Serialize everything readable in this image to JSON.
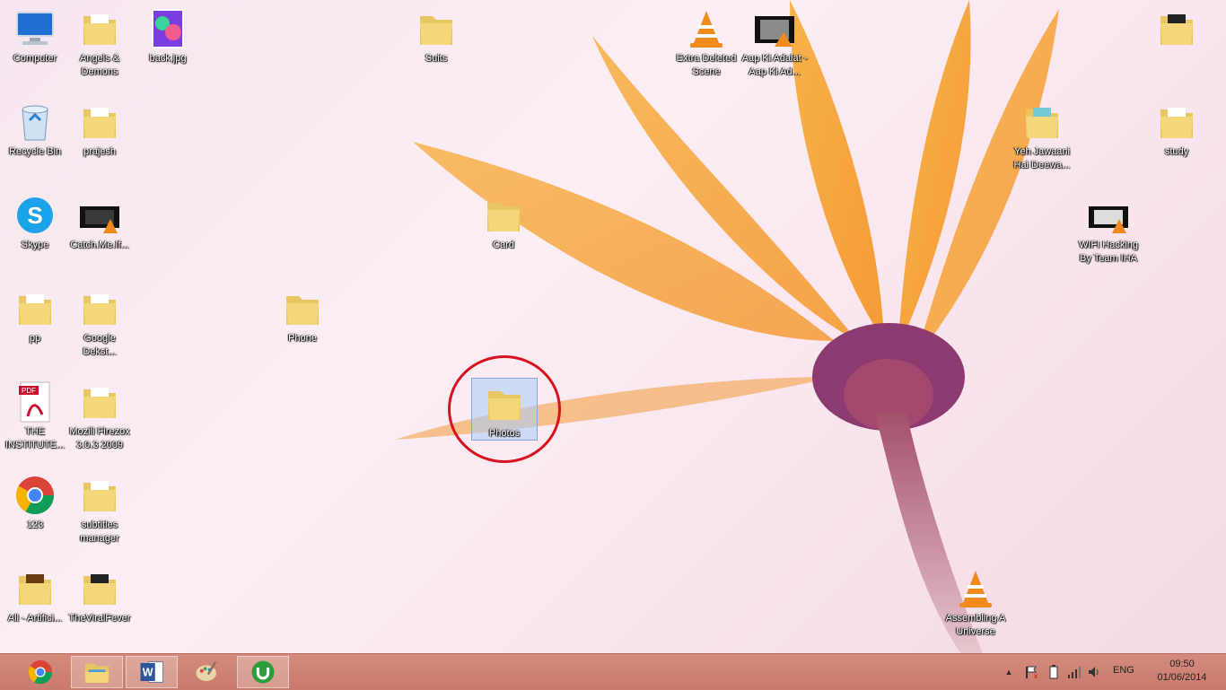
{
  "desktop": {
    "icons": [
      {
        "label": "Computer",
        "icon": "computer-icon"
      },
      {
        "label": "Angels & Demons",
        "icon": "folder-icon"
      },
      {
        "label": "back.jpg",
        "icon": "image-file-icon"
      },
      {
        "label": "Suits",
        "icon": "folder-icon"
      },
      {
        "label": "Extra Deleted Scene",
        "icon": "vlc-icon"
      },
      {
        "label": "Aap Ki Adalat - Aap Ki Ad...",
        "icon": "video-file-icon"
      },
      {
        "label": "Recycle Bin",
        "icon": "recycle-bin-icon"
      },
      {
        "label": "prajesh",
        "icon": "folder-icon"
      },
      {
        "label": "Yeh Jawaani Hai Deewa...",
        "icon": "folder-icon"
      },
      {
        "label": "study",
        "icon": "folder-icon"
      },
      {
        "label": "Skype",
        "icon": "skype-icon"
      },
      {
        "label": "Catch.Me.If...",
        "icon": "video-file-icon"
      },
      {
        "label": "Card",
        "icon": "folder-icon"
      },
      {
        "label": "WIFI Hacking By Team IHA",
        "icon": "video-file-icon"
      },
      {
        "label": "pp",
        "icon": "folder-icon"
      },
      {
        "label": "Google Dekst...",
        "icon": "folder-icon"
      },
      {
        "label": "Phone",
        "icon": "folder-icon"
      },
      {
        "label": "THE INSTITUTE...",
        "icon": "pdf-icon"
      },
      {
        "label": "Mozill Firezox 3.0.3 2009",
        "icon": "folder-icon"
      },
      {
        "label": "Photos",
        "icon": "folder-icon"
      },
      {
        "label": "123",
        "icon": "chrome-icon"
      },
      {
        "label": "subtitles manager",
        "icon": "folder-icon"
      },
      {
        "label": "All - Artifici...",
        "icon": "folder-icon"
      },
      {
        "label": "TheViralFever",
        "icon": "folder-icon"
      },
      {
        "label": "Assembling A Universe",
        "icon": "vlc-icon"
      }
    ]
  },
  "taskbar": {
    "pinned": [
      {
        "icon": "chrome-icon"
      },
      {
        "icon": "file-explorer-icon"
      },
      {
        "icon": "word-icon"
      },
      {
        "icon": "paint-icon"
      },
      {
        "icon": "utorrent-icon"
      }
    ],
    "tray": {
      "language": "ENG",
      "time": "09:50",
      "date": "01/06/2014"
    }
  },
  "colors": {
    "taskbar": "#c97a6c",
    "highlight_circle": "#d9121f",
    "selection": "#aacdf5"
  }
}
